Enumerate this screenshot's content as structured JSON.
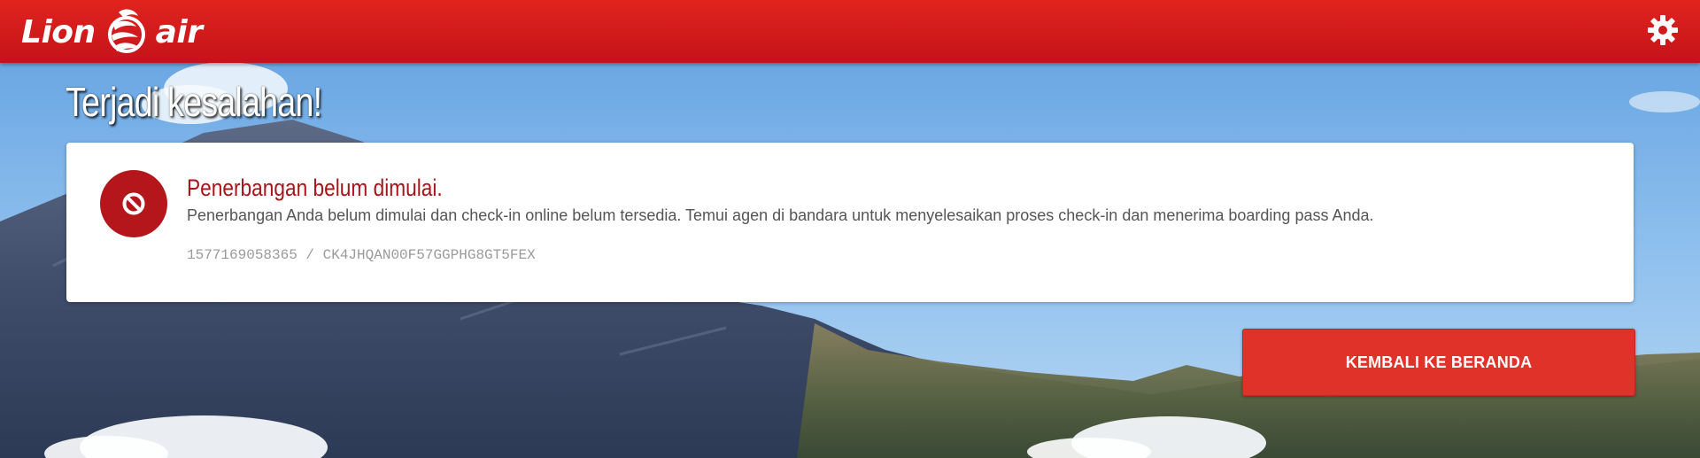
{
  "header": {
    "logo_left": "Lion",
    "logo_right": "air",
    "settings_icon": "gear-icon",
    "bar_color": "#d71e1e"
  },
  "page": {
    "title": "Terjadi kesalahan!"
  },
  "error": {
    "icon": "no-entry-icon",
    "title": "Penerbangan belum dimulai.",
    "message": "Penerbangan Anda belum dimulai dan check-in online belum tersedia. Temui agen di bandara untuk menyelesaikan proses check-in dan menerima boarding pass Anda.",
    "reference": "1577169058365 / CK4JHQAN00F57GGPHG8GT5FEX",
    "accent_color": "#b5161b"
  },
  "actions": {
    "home_label": "KEMBALI KE BERANDA",
    "button_color": "#e1322a"
  }
}
